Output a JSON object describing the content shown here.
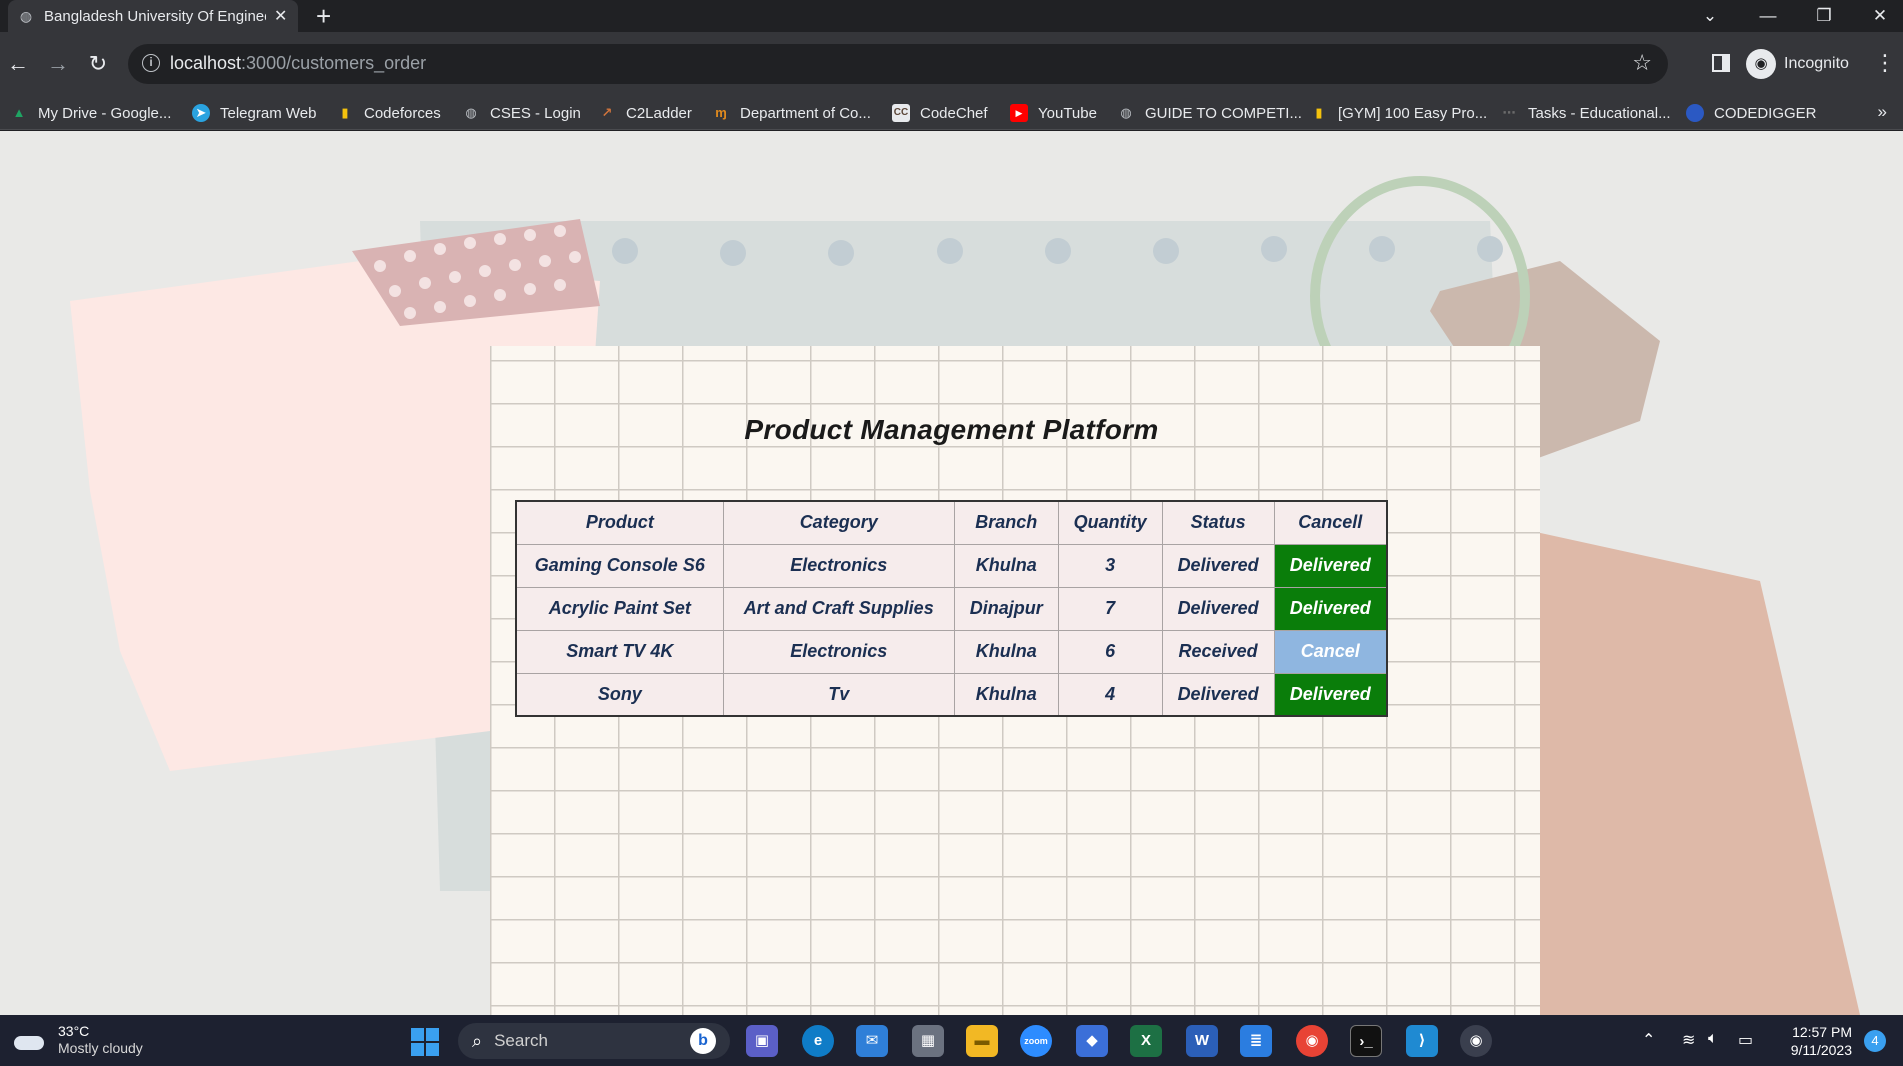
{
  "browser": {
    "tab_title": "Bangladesh University Of Enginee",
    "url_host": "localhost",
    "url_path": ":3000/customers_order",
    "profile_label": "Incognito"
  },
  "bookmarks": [
    {
      "label": "My Drive - Google...",
      "icon": "google-drive-icon",
      "color": "#1fa463"
    },
    {
      "label": "Telegram Web",
      "icon": "telegram-icon",
      "color": "#2aa3e0"
    },
    {
      "label": "Codeforces",
      "icon": "codeforces-icon",
      "color": "#1f8acb"
    },
    {
      "label": "CSES - Login",
      "icon": "globe-icon",
      "color": "#9aa0a6"
    },
    {
      "label": "C2Ladder",
      "icon": "c2ladder-icon",
      "color": "#d0743c"
    },
    {
      "label": "Department of Co...",
      "icon": "department-icon",
      "color": "#e08a1e"
    },
    {
      "label": "CodeChef",
      "icon": "codechef-icon",
      "color": "#5b4638"
    },
    {
      "label": "YouTube",
      "icon": "youtube-icon",
      "color": "#ff0000"
    },
    {
      "label": "GUIDE TO COMPETI...",
      "icon": "globe-icon",
      "color": "#9aa0a6"
    },
    {
      "label": "[GYM] 100 Easy Pro...",
      "icon": "codeforces-icon",
      "color": "#1f8acb"
    },
    {
      "label": "Tasks - Educational...",
      "icon": "tasks-icon",
      "color": "#6b6b6b"
    },
    {
      "label": "CODEDIGGER",
      "icon": "codedigger-icon",
      "color": "#2b59c3"
    }
  ],
  "page": {
    "heading": "Product Management Platform",
    "columns": [
      "Product",
      "Category",
      "Branch",
      "Quantity",
      "Status",
      "Cancell"
    ],
    "rows": [
      {
        "product": "Gaming Console S6",
        "category": "Electronics",
        "branch": "Khulna",
        "quantity": "3",
        "status": "Delivered",
        "action": "Delivered",
        "action_state": "delivered"
      },
      {
        "product": "Acrylic Paint Set",
        "category": "Art and Craft Supplies",
        "branch": "Dinajpur",
        "quantity": "7",
        "status": "Delivered",
        "action": "Delivered",
        "action_state": "delivered"
      },
      {
        "product": "Smart TV 4K",
        "category": "Electronics",
        "branch": "Khulna",
        "quantity": "6",
        "status": "Received",
        "action": "Cancel",
        "action_state": "cancel"
      },
      {
        "product": "Sony",
        "category": "Tv",
        "branch": "Khulna",
        "quantity": "4",
        "status": "Delivered",
        "action": "Delivered",
        "action_state": "delivered"
      }
    ],
    "colors": {
      "delivered": "#0a7d0a",
      "cancel": "#8fb6e0",
      "text": "#1b2f52"
    }
  },
  "taskbar": {
    "temperature": "33°C",
    "weather": "Mostly cloudy",
    "search_placeholder": "Search",
    "time": "12:57 PM",
    "date": "9/11/2023",
    "notifications": "4"
  }
}
